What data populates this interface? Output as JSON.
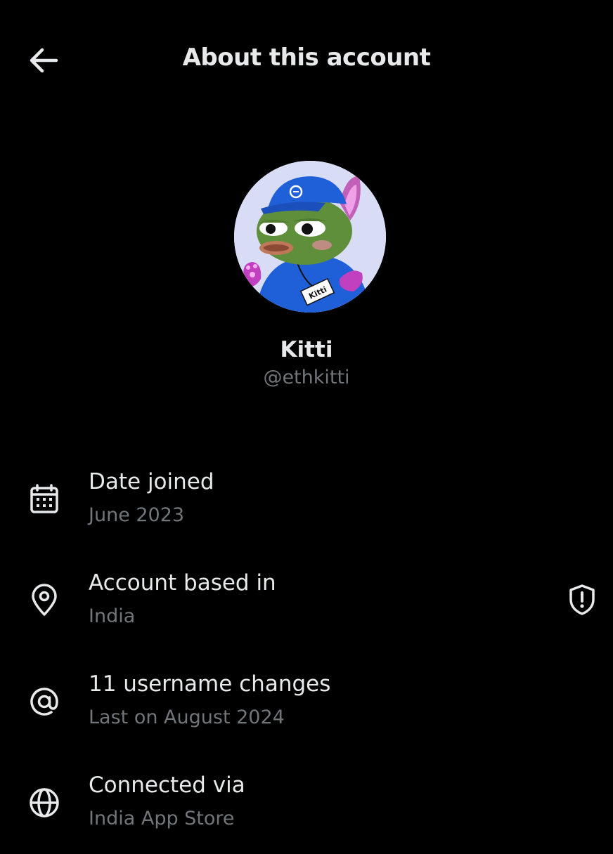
{
  "header": {
    "title": "About this account",
    "back_icon": "arrow-left-icon"
  },
  "profile": {
    "display_name": "Kitti",
    "handle": "@ethkitti",
    "avatar_badge_text": "Kitti"
  },
  "rows": [
    {
      "icon": "calendar-icon",
      "title": "Date joined",
      "subtitle": "June 2023"
    },
    {
      "icon": "location-pin-icon",
      "title": "Account based in",
      "subtitle": "India",
      "trailing_icon": "shield-alert-icon"
    },
    {
      "icon": "at-sign-icon",
      "title": "11 username changes",
      "subtitle": "Last on August 2024"
    },
    {
      "icon": "globe-icon",
      "title": "Connected via",
      "subtitle": "India App Store"
    }
  ],
  "colors": {
    "background": "#000000",
    "primary_text": "#e7e9ea",
    "secondary_text": "#71767b"
  }
}
